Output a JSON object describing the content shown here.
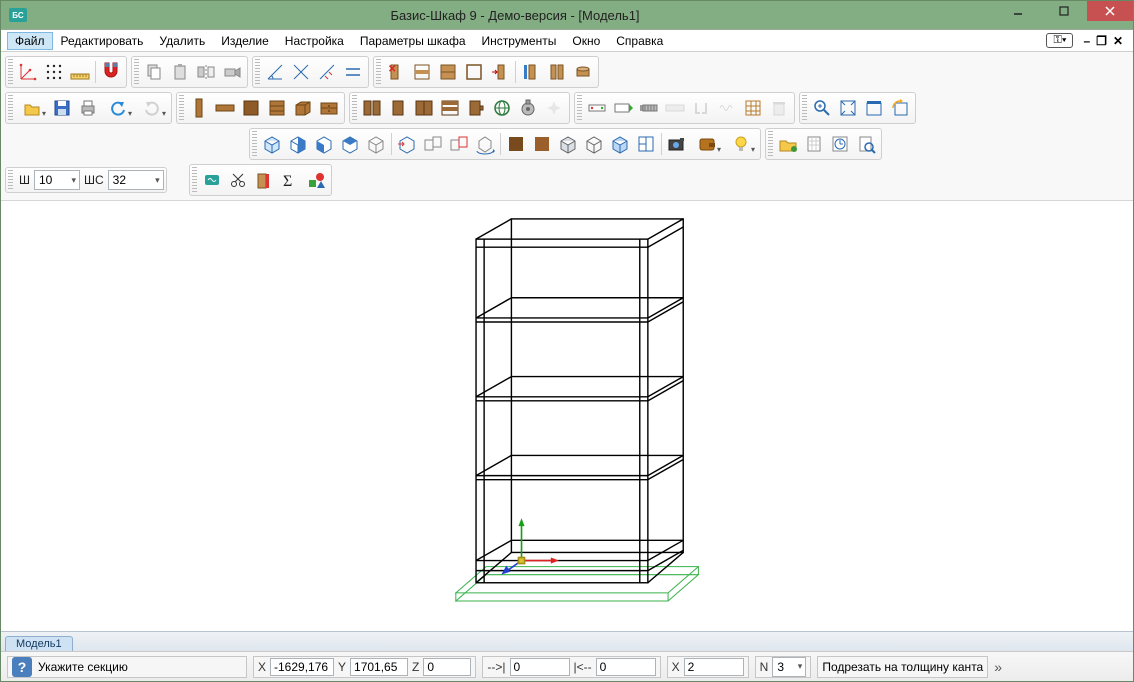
{
  "window": {
    "title": "Базис-Шкаф 9 - Демо-версия - [Модель1]"
  },
  "menu": {
    "items": [
      "Файл",
      "Редактировать",
      "Удалить",
      "Изделие",
      "Настройка",
      "Параметры шкафа",
      "Инструменты",
      "Окно",
      "Справка"
    ],
    "key_badge": "⚿▾"
  },
  "params": {
    "sh_label": "Ш",
    "sh_value": "10",
    "shs_label": "ШС",
    "shs_value": "32"
  },
  "tabs": {
    "model": "Модель1"
  },
  "status": {
    "hint": "Укажите секцию",
    "x_label": "X",
    "x_value": "-1629,176",
    "y_label": "Y",
    "y_value": "1701,65",
    "z_label": "Z",
    "z_value": "0",
    "arrow_right_label": "-->|",
    "arrow_right_value": "0",
    "arrow_left_label": "|<--",
    "arrow_left_value": "0",
    "x2_label": "X",
    "x2_value": "2",
    "n_label": "N",
    "n_value": "3",
    "trim_button": "Подрезать на толщину канта"
  }
}
